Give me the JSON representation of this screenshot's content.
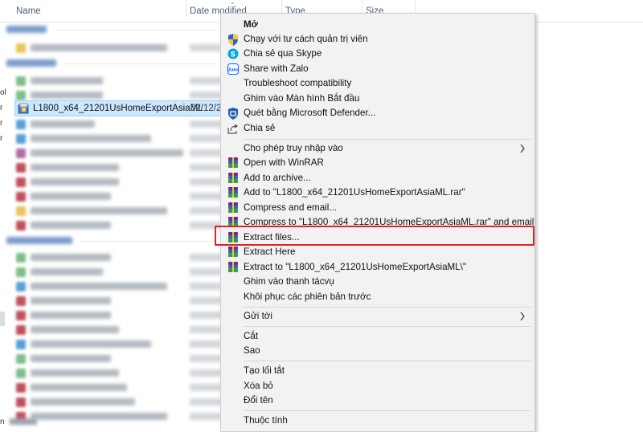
{
  "columns": {
    "name": "Name",
    "date_modified": "Date modified",
    "type": "Type",
    "size": "Size"
  },
  "left_edge_chars": [
    "ol",
    "r",
    "r",
    "r"
  ],
  "selected_file": {
    "name": "L1800_x64_21201UsHomeExportAsiaML",
    "date": "02/12/20"
  },
  "status": {
    "prefix": "n"
  },
  "context_menu": {
    "open": "Mở",
    "run_as_admin": "Chạy với tư cách quản trị viên",
    "share_skype": "Chia sẻ qua Skype",
    "share_zalo": "Share with Zalo",
    "troubleshoot": "Troubleshoot compatibility",
    "pin_start": "Ghim vào Màn hình Bắt đầu",
    "defender": "Quét bằng Microsoft Defender...",
    "share": "Chia sẻ",
    "give_access": "Cho phép truy nhập vào",
    "open_winrar": "Open with WinRAR",
    "add_archive": "Add to archive...",
    "add_to_rar": "Add to \"L1800_x64_21201UsHomeExportAsiaML.rar\"",
    "compress_email": "Compress and email...",
    "compress_to_rar_email": "Compress to \"L1800_x64_21201UsHomeExportAsiaML.rar\" and email",
    "extract_files": "Extract files...",
    "extract_here": "Extract Here",
    "extract_to": "Extract to \"L1800_x64_21201UsHomeExportAsiaML\\\"",
    "pin_taskbar": "Ghim vào thanh tácvụ",
    "restore_versions": "Khôi phục các phiên bản trước",
    "send_to": "Gửi tới",
    "cut": "Cắt",
    "copy": "Sao",
    "create_shortcut": "Tạo lối tắt",
    "delete": "Xóa bỏ",
    "rename": "Đổi tên",
    "properties": "Thuộc tính"
  },
  "colors": {
    "highlight_box": "#d9242b",
    "selection": "#cce8ff",
    "menu_bg": "#f2f2f2"
  }
}
